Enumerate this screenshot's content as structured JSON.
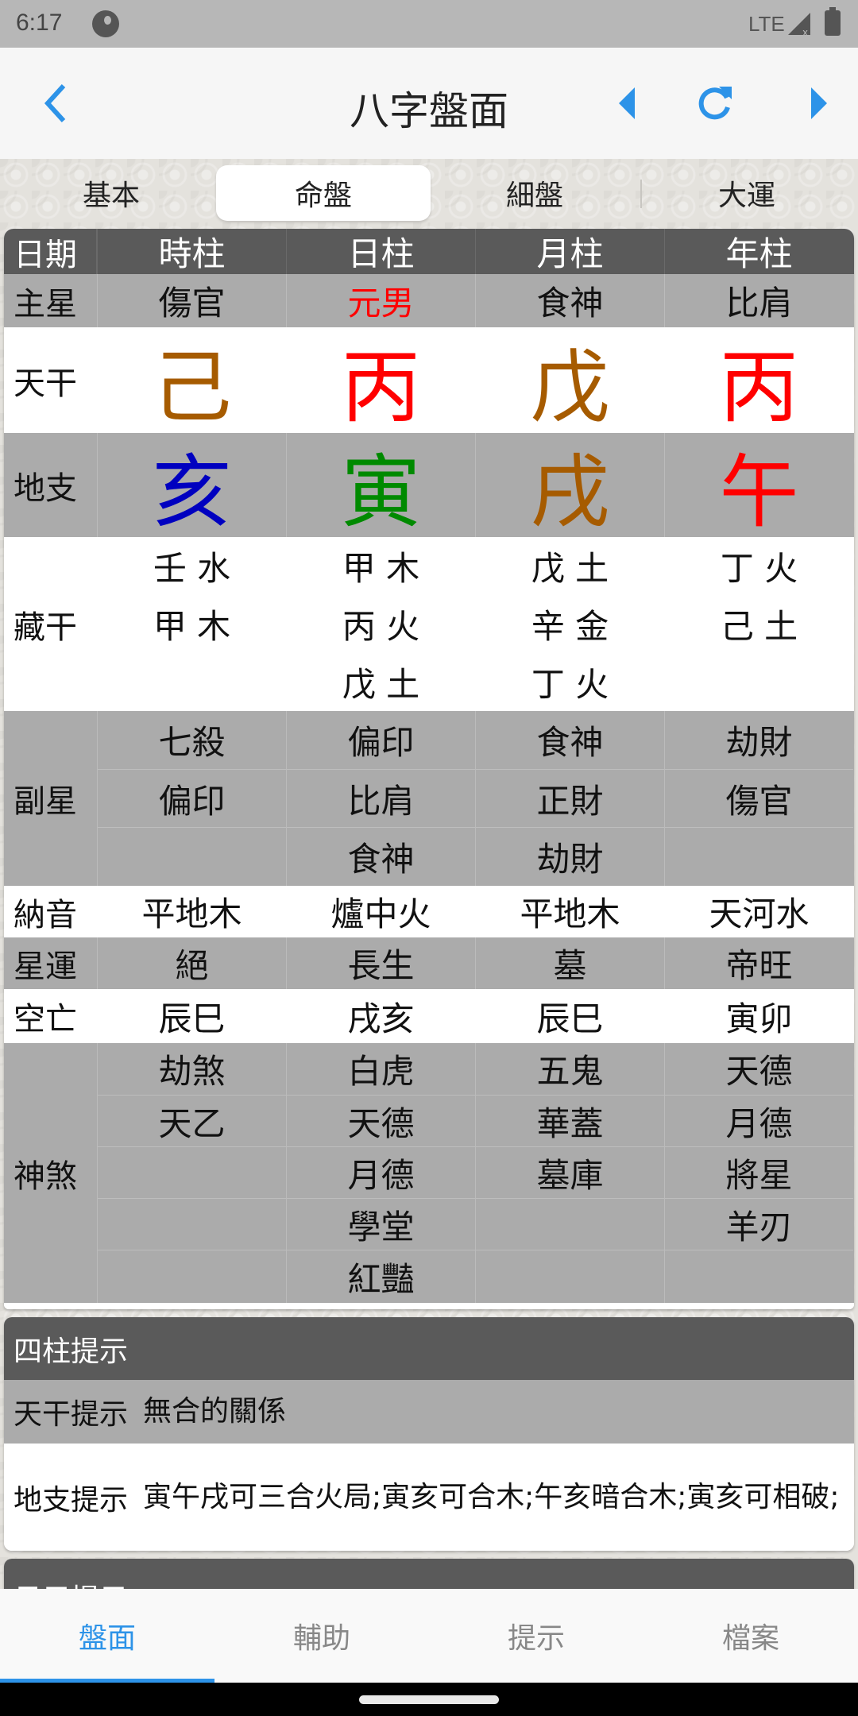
{
  "status_bar": {
    "time": "6:17",
    "network": "LTE"
  },
  "header": {
    "title": "八字盤面",
    "back_icon": "chevron-left-icon",
    "prev_icon": "triangle-left-icon",
    "refresh_icon": "refresh-icon",
    "next_icon": "triangle-right-icon"
  },
  "colors": {
    "accent": "#2d93e8",
    "earth": "#a65b00",
    "fire": "#ff0000",
    "water": "#0000c0",
    "wood": "#008a00",
    "header_dark": "#5a5a5a",
    "row_grey": "#ababab"
  },
  "segments": [
    {
      "label": "基本",
      "active": false
    },
    {
      "label": "命盤",
      "active": true
    },
    {
      "label": "細盤",
      "active": false
    },
    {
      "label": "大運",
      "active": false
    }
  ],
  "chart": {
    "header": {
      "label": "日期",
      "columns": [
        "時柱",
        "日柱",
        "月柱",
        "年柱"
      ]
    },
    "main_star": {
      "label": "主星",
      "values": [
        "傷官",
        "元男",
        "食神",
        "比肩"
      ]
    },
    "heavenly_stems": {
      "label": "天干",
      "values": [
        "己",
        "丙",
        "戊",
        "丙"
      ]
    },
    "earthly_branches": {
      "label": "地支",
      "values": [
        "亥",
        "寅",
        "戌",
        "午"
      ]
    },
    "hidden_stems": {
      "label": "藏干",
      "values": [
        [
          "壬 水",
          "甲 木"
        ],
        [
          "甲 木",
          "丙 火",
          "戊 土"
        ],
        [
          "戊 土",
          "辛 金",
          "丁 火"
        ],
        [
          "丁 火",
          "己 土"
        ]
      ]
    },
    "sub_stars": {
      "label": "副星",
      "values": [
        [
          "七殺",
          "偏印"
        ],
        [
          "偏印",
          "比肩",
          "食神"
        ],
        [
          "食神",
          "正財",
          "劫財"
        ],
        [
          "劫財",
          "傷官"
        ]
      ]
    },
    "nayin": {
      "label": "納音",
      "values": [
        "平地木",
        "爐中火",
        "平地木",
        "天河水"
      ]
    },
    "star_luck": {
      "label": "星運",
      "values": [
        "絕",
        "長生",
        "墓",
        "帝旺"
      ]
    },
    "void": {
      "label": "空亡",
      "values": [
        "辰巳",
        "戌亥",
        "辰巳",
        "寅卯"
      ]
    },
    "spirits": {
      "label": "神煞",
      "values": [
        [
          "劫煞",
          "天乙"
        ],
        [
          "白虎",
          "天德",
          "月德",
          "學堂",
          "紅豔"
        ],
        [
          "五鬼",
          "華蓋",
          "墓庫"
        ],
        [
          "天德",
          "月德",
          "將星",
          "羊刃"
        ]
      ]
    }
  },
  "pillar_hints": {
    "title": "四柱提示",
    "stem_hint": {
      "label": "天干提示",
      "value": "無合的關係"
    },
    "branch_hint": {
      "label": "地支提示",
      "value": "寅午戌可三合火局;寅亥可合木;午亥暗合木;寅亥可相破;"
    }
  },
  "next_card": {
    "title": "日元提示"
  },
  "bottom_nav": [
    {
      "label": "盤面",
      "active": true
    },
    {
      "label": "輔助",
      "active": false
    },
    {
      "label": "提示",
      "active": false
    },
    {
      "label": "檔案",
      "active": false
    }
  ]
}
